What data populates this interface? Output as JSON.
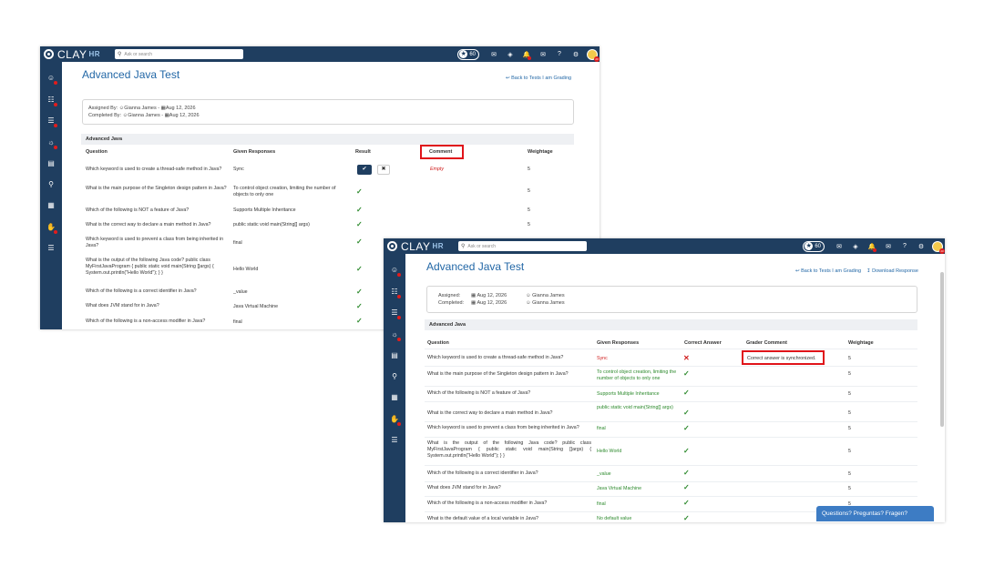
{
  "app": {
    "logo_text": "CLAY",
    "logo_suffix": "HR",
    "search_placeholder": "Ask or search",
    "points": "60",
    "avatar_badge": "20"
  },
  "sidebar_icons": [
    "users-icon",
    "invoice-icon",
    "org-chart-icon",
    "lightbulb-icon",
    "document-icon",
    "search-doc-icon",
    "report-icon",
    "hand-coin-icon",
    "clipboard-icon"
  ],
  "w1": {
    "title": "Advanced Java Test",
    "back_link": "Back to Tests I am Grading",
    "assigned_by_label": "Assigned By:",
    "assigned_by": "Gianna James",
    "assigned_date": "Aug 12, 2026",
    "completed_by_label": "Completed By:",
    "completed_by": "Gianna James",
    "completed_date": "Aug 12, 2026",
    "section": "Advanced Java",
    "headers": {
      "question": "Question",
      "responses": "Given Responses",
      "result": "Result",
      "comment": "Comment",
      "weightage": "Weightage"
    },
    "first_comment": "Empty",
    "rows": [
      {
        "q": "Which keyword is used to create a thread-safe method in Java?",
        "a": "Sync",
        "w": "5"
      },
      {
        "q": "What is the main purpose of the Singleton design pattern in Java?",
        "a": "To control object creation, limiting the number of objects to only one",
        "w": "5"
      },
      {
        "q": "Which of the following is NOT a feature of Java?",
        "a": "Supports Multiple Inheritance",
        "w": "5"
      },
      {
        "q": "What is the correct way to declare a main method in Java?",
        "a": "public static void main(String[] args)",
        "w": "5"
      },
      {
        "q": "Which keyword is used to prevent a class from being inherited in Java?",
        "a": "final",
        "w": ""
      },
      {
        "q": "What is the output of the following Java code? public class MyFirstJavaProgram { public static void main(String []args) { System.out.println(\"Hello World\"); } }",
        "a": "Hello World",
        "w": ""
      },
      {
        "q": "Which of the following is a correct identifier in Java?",
        "a": "_value",
        "w": ""
      },
      {
        "q": "What does JVM stand for in Java?",
        "a": "Java Virtual Machine",
        "w": ""
      },
      {
        "q": "Which of the following is a non-access modifier in Java?",
        "a": "final",
        "w": ""
      }
    ]
  },
  "w2": {
    "title": "Advanced Java Test",
    "back_link": "Back to Tests I am Grading",
    "download_link": "Download Response",
    "assigned_label": "Assigned:",
    "assigned_date": "Aug 12, 2026",
    "assigned_by": "Gianna James",
    "completed_label": "Completed:",
    "completed_date": "Aug 12, 2026",
    "completed_by": "Gianna James",
    "section": "Advanced Java",
    "headers": {
      "question": "Question",
      "responses": "Given Responses",
      "correct": "Correct Answer",
      "grader": "Grader Comment",
      "weightage": "Weightage"
    },
    "grader_comment": "Correct answer is synchronized.",
    "rows": [
      {
        "q": "Which keyword is used to create a thread-safe method in Java?",
        "a": "Sync",
        "w": "5"
      },
      {
        "q": "What is the main purpose of the Singleton design pattern in Java?",
        "a": "To control object creation, limiting the number of objects to only one",
        "w": "5"
      },
      {
        "q": "Which of the following is NOT a feature of Java?",
        "a": "Supports Multiple Inheritance",
        "w": "5"
      },
      {
        "q": "What is the correct way to declare a main method in Java?",
        "a": "public static void main(String[] args)",
        "w": "5"
      },
      {
        "q": "Which keyword is used to prevent a class from being inherited in Java?",
        "a": "final",
        "w": "5"
      },
      {
        "q": "What is the output of the following Java code? public class MyFirstJavaProgram { public static void main(String []args) { System.out.println(\"Hello World\"); } }",
        "a": "Hello World",
        "w": "5"
      },
      {
        "q": "Which of the following is a correct identifier in Java?",
        "a": "_value",
        "w": "5"
      },
      {
        "q": "What does JVM stand for in Java?",
        "a": "Java Virtual Machine",
        "w": "5"
      },
      {
        "q": "Which of the following is a non-access modifier in Java?",
        "a": "final",
        "w": "5"
      },
      {
        "q": "What is the default value of a local variable in Java?",
        "a": "No default value",
        "w": ""
      }
    ],
    "chat_label": "Questions? Preguntas? Fragen?"
  },
  "colors": {
    "nav": "#1f3e60",
    "link": "#2267a6",
    "correct": "#2d8a2d",
    "wrong": "#d02020",
    "highlight": "#e0141a"
  }
}
